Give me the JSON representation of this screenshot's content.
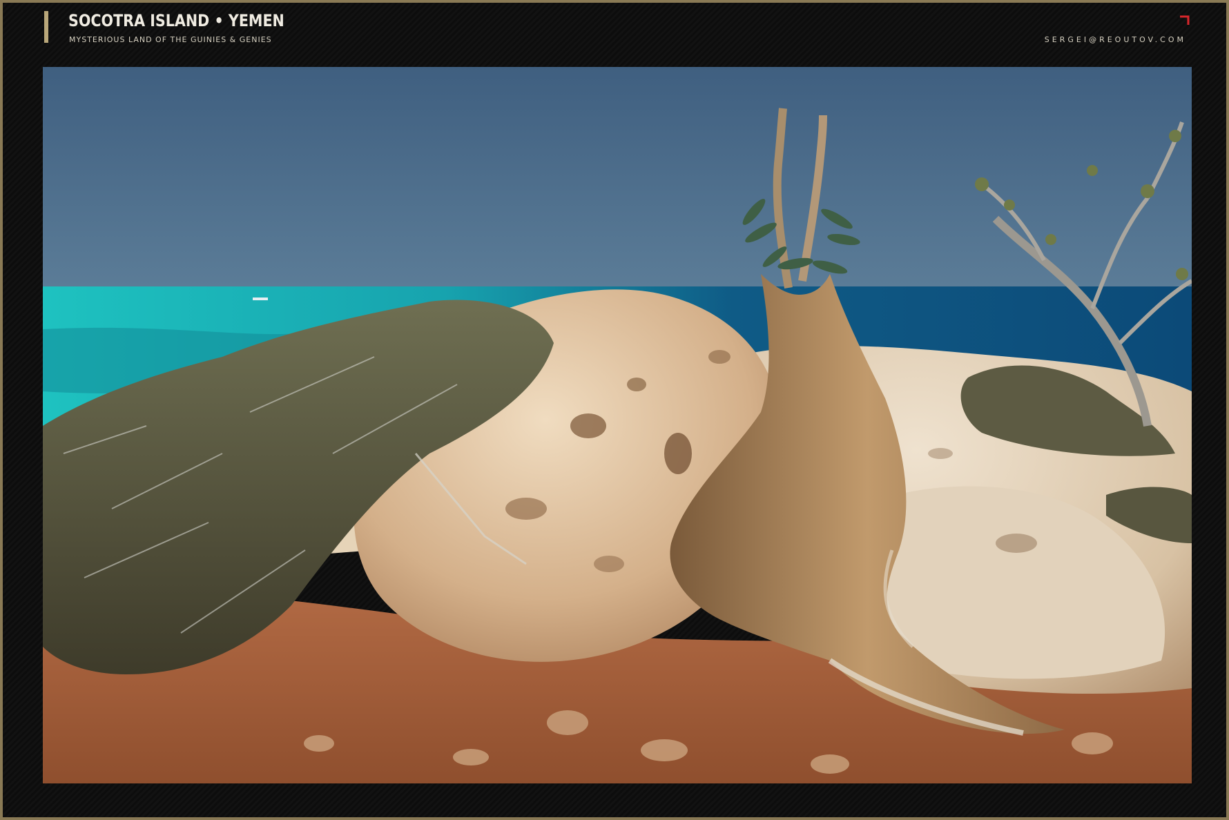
{
  "header": {
    "title": "SOCOTRA ISLAND • YEMEN",
    "subtitle": "MYSTERIOUS LAND OF THE GUINIES & GENIES",
    "email": "SERGEI@REOUTOV.COM"
  },
  "colors": {
    "frame_border": "#8a7a55",
    "accent_bar": "#b9a77a",
    "corner_mark": "#d8262b",
    "sky": "#4a6a8a",
    "sea": "#1fb2b0",
    "rock": "#d9c0a0",
    "soil": "#a8603a",
    "plant": "#a8825a"
  },
  "icons": {
    "corner": "corner-bracket-icon"
  }
}
